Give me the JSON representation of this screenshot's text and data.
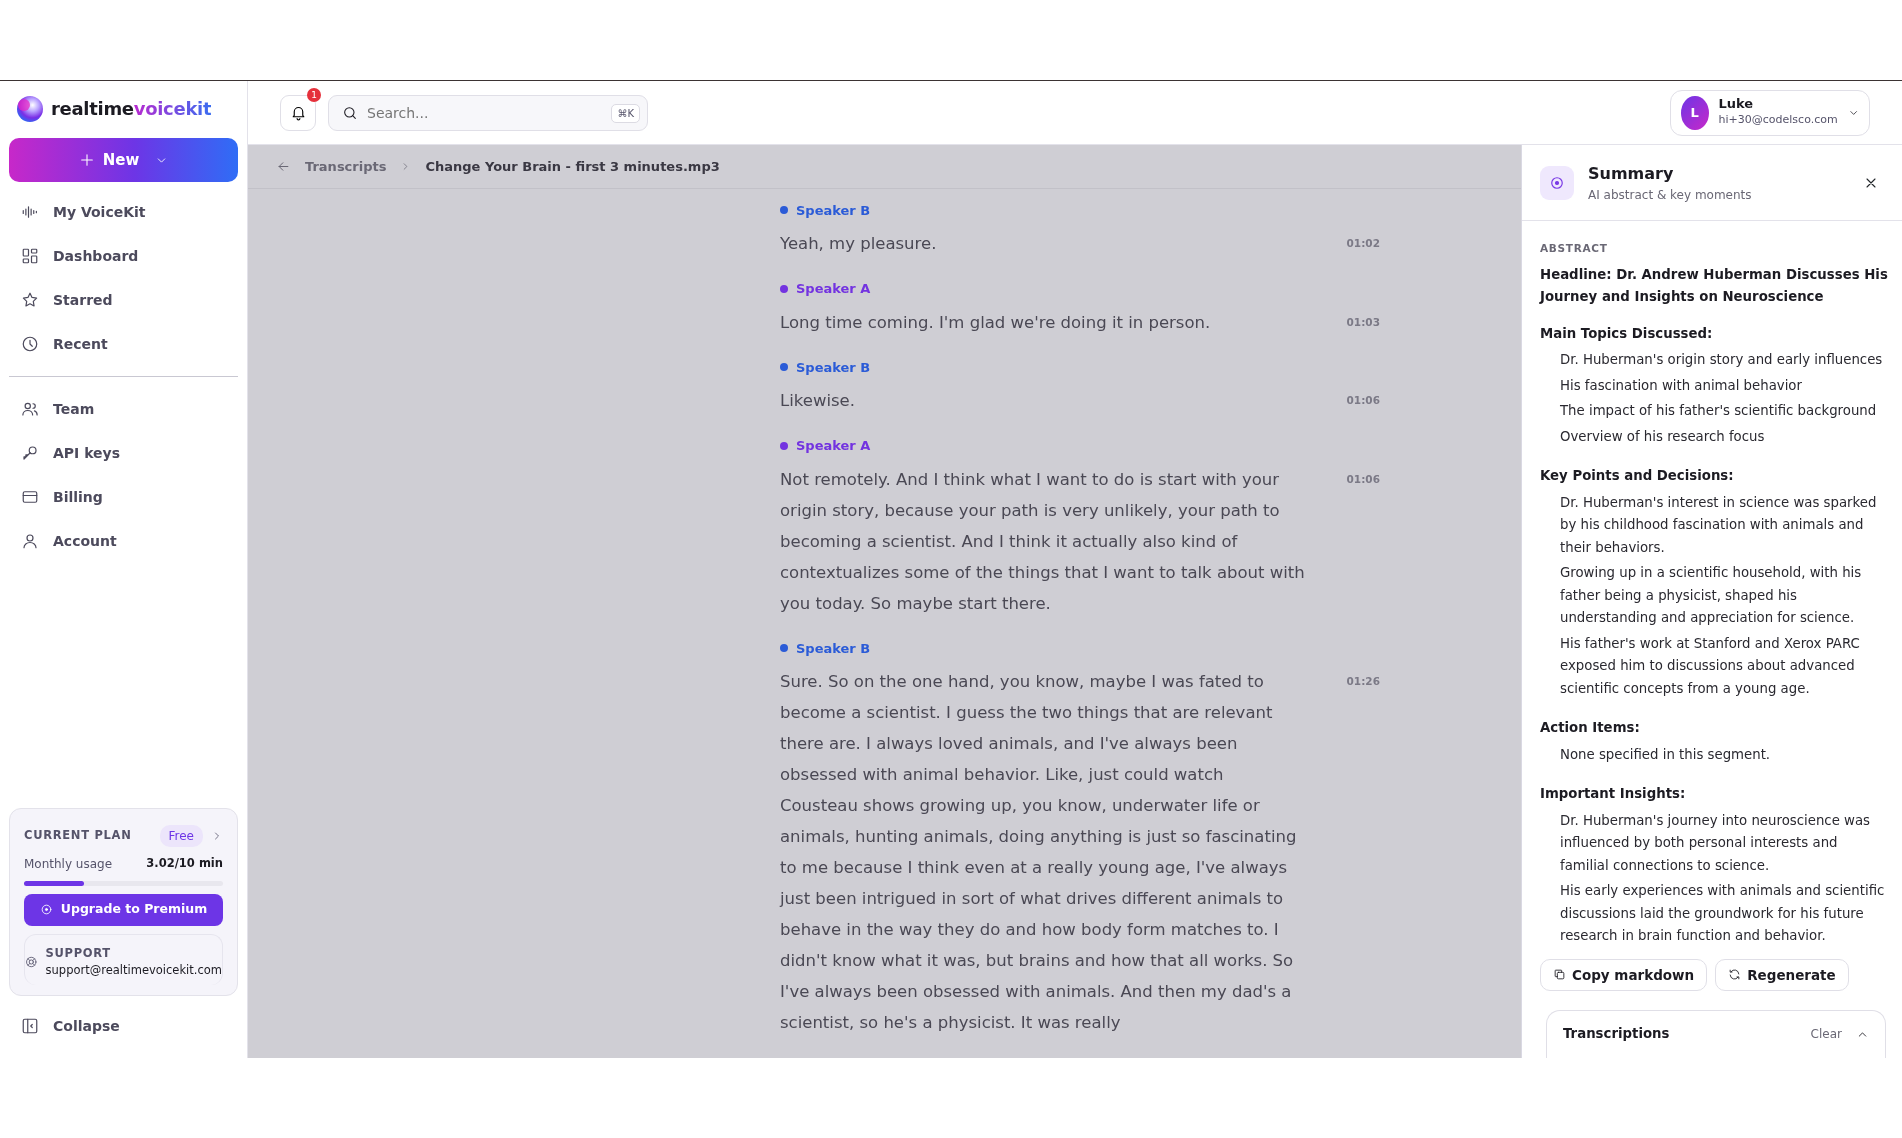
{
  "logo": {
    "first": "realtime",
    "second": "voicekit"
  },
  "new_button": {
    "label": "New"
  },
  "nav_main": [
    {
      "label": "My VoiceKit"
    },
    {
      "label": "Dashboard"
    },
    {
      "label": "Starred"
    },
    {
      "label": "Recent"
    }
  ],
  "nav_account": [
    {
      "label": "Team"
    },
    {
      "label": "API keys"
    },
    {
      "label": "Billing"
    },
    {
      "label": "Account"
    }
  ],
  "plan": {
    "title": "CURRENT PLAN",
    "badge": "Free",
    "usage_label": "Monthly usage",
    "usage_value": "3.02/10 min",
    "level": 0.302,
    "upgrade_button": "Upgrade to Premium"
  },
  "support": {
    "title": "SUPPORT",
    "email": "support@realtimevoicekit.com"
  },
  "collapse": {
    "label": "Collapse"
  },
  "header": {
    "notification_count": "1",
    "search": {
      "placeholder": "Search...",
      "shortcut": "⌘K"
    },
    "user": {
      "initial": "L",
      "name": "Luke",
      "email": "hi+30@codelsco.com"
    }
  },
  "breadcrumb": [
    "Transcripts",
    "Change Your Brain - first 3 minutes.mp3"
  ],
  "transcript": [
    {
      "speaker": "Speaker B",
      "color": "#2b5bd7",
      "text": "Yeah, my pleasure.",
      "time": "01:02"
    },
    {
      "speaker": "Speaker A",
      "color": "#7333e0",
      "text": "Long time coming. I'm glad we're doing it in person.",
      "time": "01:03"
    },
    {
      "speaker": "Speaker B",
      "color": "#2b5bd7",
      "text": "Likewise.",
      "time": "01:06"
    },
    {
      "speaker": "Speaker A",
      "color": "#7333e0",
      "text": "Not remotely. And I think what I want to do is start with your origin story, because your path is very unlikely, your path to becoming a scientist. And I think it actually also kind of contextualizes some of the things that I want to talk about with you today. So maybe start there.",
      "time": "01:06"
    },
    {
      "speaker": "Speaker B",
      "color": "#2b5bd7",
      "text": "Sure. So on the one hand, you know, maybe I was fated to become a scientist. I guess the two things that are relevant there are. I always loved animals, and I've always been obsessed with animal behavior. Like, just could watch Cousteau shows growing up, you know, underwater life or animals, hunting animals, doing anything is just so fascinating to me because I think even at a really young age, I've always just been intrigued in sort of what drives different animals to behave in the way they do and how body form matches to. I didn't know what it was, but brains and how that all works. So I've always been obsessed with animals. And then my dad's a scientist, so he's a physicist. It was really",
      "time": "01:26"
    }
  ],
  "summary": {
    "title": "Summary",
    "subtitle": "AI abstract & key moments",
    "section_label": "ABSTRACT",
    "headline": "Headline: Dr. Andrew Huberman Discusses His Journey and Insights on Neuroscience",
    "sections": [
      {
        "heading": "Main Topics Discussed:",
        "items": [
          "Dr. Huberman's origin story and early influences",
          "His fascination with animal behavior",
          "The impact of his father's scientific background",
          "Overview of his research focus"
        ]
      },
      {
        "heading": "Key Points and Decisions:",
        "items": [
          "Dr. Huberman's interest in science was sparked by his childhood fascination with animals and their behaviors.",
          "Growing up in a scientific household, with his father being a physicist, shaped his understanding and appreciation for science.",
          "His father's work at Stanford and Xerox PARC exposed him to discussions about advanced scientific concepts from a young age."
        ]
      },
      {
        "heading": "Action Items:",
        "items": [
          "None specified in this segment."
        ]
      },
      {
        "heading": "Important Insights:",
        "items": [
          "Dr. Huberman's journey into neuroscience was influenced by both personal interests and familial connections to science.",
          "His early experiences with animals and scientific discussions laid the groundwork for his future research in brain function and behavior."
        ]
      }
    ],
    "buttons": [
      "Copy markdown",
      "Regenerate"
    ],
    "transcriptions": {
      "title": "Transcriptions",
      "clear": "Clear"
    }
  }
}
